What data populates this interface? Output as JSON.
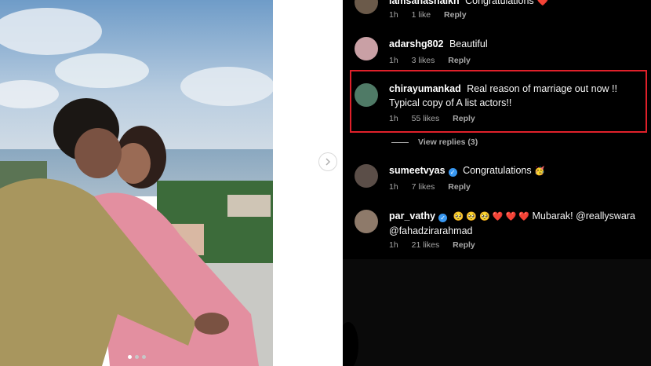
{
  "post": {
    "carousel_dots": [
      true,
      false,
      false
    ]
  },
  "comments": [
    {
      "username": "lamsahashaikh",
      "text": "Congratulations ❤️",
      "time": "1h",
      "likes": "1 like",
      "reply": "Reply"
    },
    {
      "username": "adarshg802",
      "text": "Beautiful",
      "time": "1h",
      "likes": "3 likes",
      "reply": "Reply"
    },
    {
      "username": "chirayumankad",
      "text": "Real reason of marriage out now !! Typical copy of A list actors!!",
      "time": "1h",
      "likes": "55 likes",
      "reply": "Reply",
      "view_replies": "View replies (3)"
    },
    {
      "username": "sumeetvyas",
      "text": "Congratulations",
      "emoji": "🥳",
      "time": "1h",
      "likes": "7 likes",
      "reply": "Reply"
    },
    {
      "username": "par_vathy",
      "emojis": "🥺 🥺 🥺 ❤️ ❤️ ❤️",
      "text": "Mubarak! @reallyswara @fahadzirarahmad",
      "time": "1h",
      "likes": "21 likes",
      "reply": "Reply"
    }
  ],
  "colors": {
    "panel_bg": "#000000",
    "highlight_border": "#e0202a",
    "verified": "#3897f0",
    "meta_text": "#a8a8a8"
  }
}
